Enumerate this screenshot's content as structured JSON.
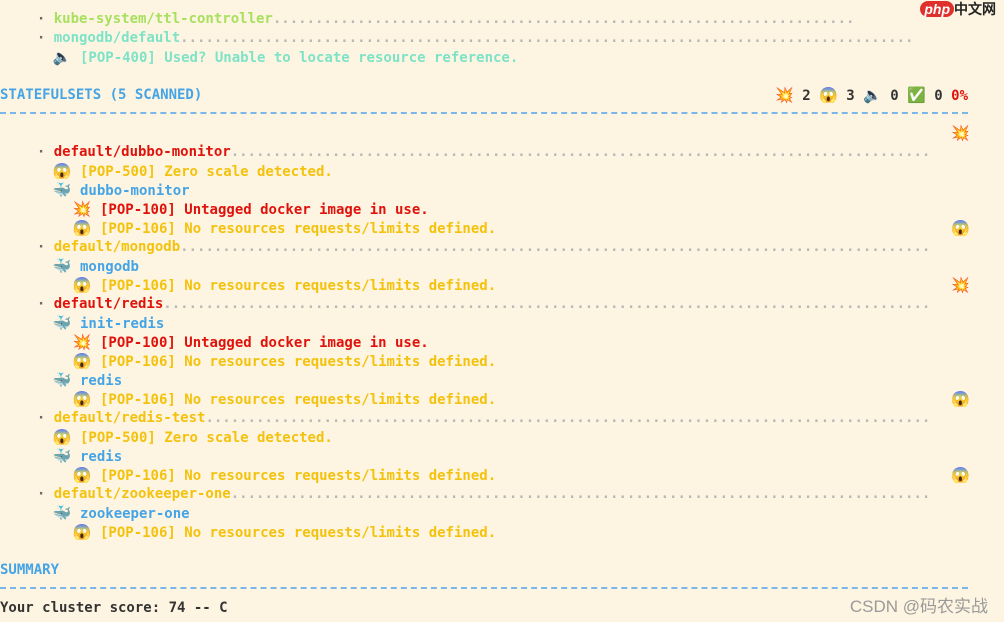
{
  "top": {
    "prev_item_1": "kube-system/ttl-controller",
    "prev_item_2": "mongodb/default",
    "prev_item_2_issue": "[POP-400] Used? Unable to locate resource reference."
  },
  "statefulsets": {
    "header": "STATEFULSETS (5 SCANNED)",
    "counts": {
      "error": "2",
      "warning": "3",
      "info": "0",
      "ok": "0",
      "score": "0",
      "pct_sign": "%"
    },
    "rows": [
      {
        "name": "default/dubbo-monitor"
      },
      {
        "issue": "[POP-500] Zero scale detected."
      },
      {
        "container": "dubbo-monitor"
      },
      {
        "issue": "[POP-100] Untagged docker image in use."
      },
      {
        "issue": "[POP-106] No resources requests/limits defined."
      },
      {
        "name": "default/mongodb"
      },
      {
        "container": "mongodb"
      },
      {
        "issue": "[POP-106] No resources requests/limits defined."
      },
      {
        "name": "default/redis"
      },
      {
        "container": "init-redis"
      },
      {
        "issue": "[POP-100] Untagged docker image in use."
      },
      {
        "issue": "[POP-106] No resources requests/limits defined."
      },
      {
        "container": "redis"
      },
      {
        "issue": "[POP-106] No resources requests/limits defined."
      },
      {
        "name": "default/redis-test"
      },
      {
        "issue": "[POP-500] Zero scale detected."
      },
      {
        "container": "redis"
      },
      {
        "issue": "[POP-106] No resources requests/limits defined."
      },
      {
        "name": "default/zookeeper-one"
      },
      {
        "container": "zookeeper-one"
      },
      {
        "issue": "[POP-106] No resources requests/limits defined."
      }
    ]
  },
  "summary": {
    "header": "SUMMARY",
    "score_line": "Your cluster score: 74 -- C"
  },
  "watermarks": {
    "php": "php",
    "php_cn": "中文网",
    "csdn": "CSDN @码农实战"
  },
  "colors": {
    "background": "#fdf5e1",
    "ok": "#a8e05f",
    "warning": "#f4c20d",
    "error": "#e0120c",
    "info": "#45a4e6",
    "teal": "#7de3c8"
  }
}
